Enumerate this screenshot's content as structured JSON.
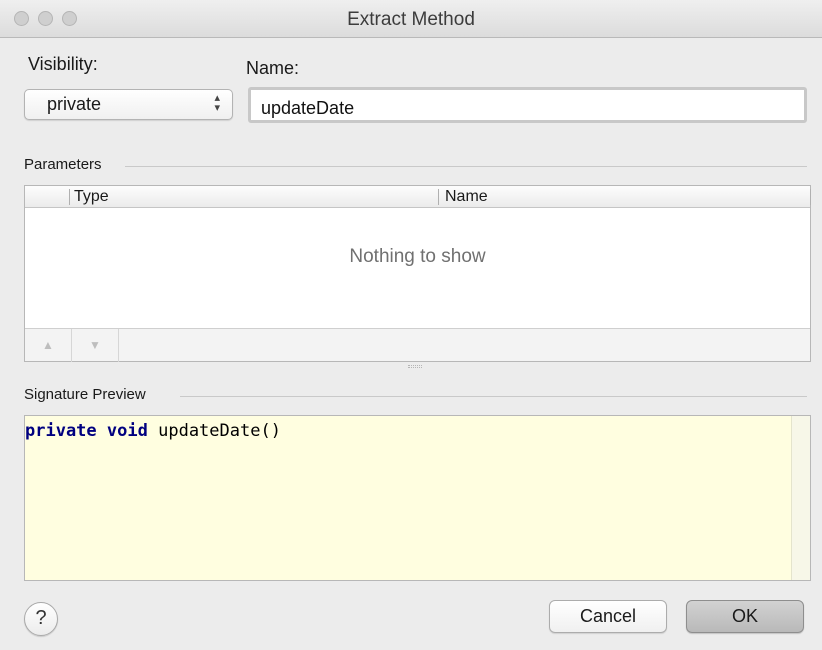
{
  "window": {
    "title": "Extract Method"
  },
  "visibility": {
    "label": "Visibility:",
    "selected": "private"
  },
  "name": {
    "label": "Name:",
    "value": "updateDate"
  },
  "parameters": {
    "section_label": "Parameters",
    "columns": [
      "Type",
      "Name"
    ],
    "empty_text": "Nothing to show",
    "move_up_icon": "triangle-up-icon",
    "move_down_icon": "triangle-down-icon"
  },
  "signature_preview": {
    "section_label": "Signature Preview",
    "keyword_1": "private",
    "keyword_2": "void",
    "method": "updateDate()"
  },
  "footer": {
    "help_label": "?",
    "cancel_label": "Cancel",
    "ok_label": "OK"
  }
}
